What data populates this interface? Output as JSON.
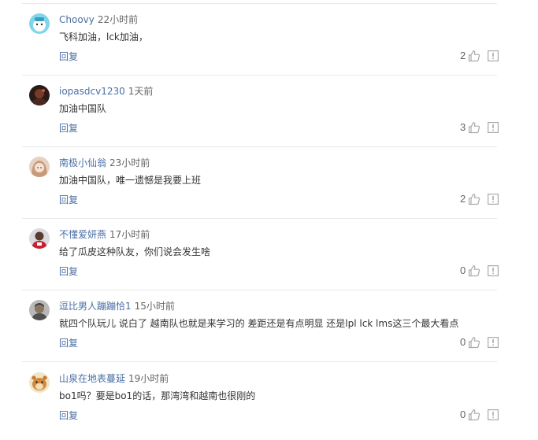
{
  "reply_label": "回复",
  "colors": {
    "username": "#4a6fa5",
    "time": "#666666",
    "text": "#333333",
    "divider": "#e9e9e9",
    "icon": "#aaaaaa"
  },
  "icons": {
    "like": "thumbs-up-icon",
    "report": "report-flag-icon"
  },
  "comments": [
    {
      "username": "Choovy",
      "time": "22小时前",
      "text": "飞科加油，lck加油，",
      "likes": "2",
      "avatar": "cartoon-face-avatar"
    },
    {
      "username": "iopasdcv1230",
      "time": "1天前",
      "text": "加油中国队",
      "likes": "3",
      "avatar": "dark-photo-avatar"
    },
    {
      "username": "南极小仙翁",
      "time": "23小时前",
      "text": "加油中国队，唯一遗憾是我要上班",
      "likes": "2",
      "avatar": "anime-girl-avatar"
    },
    {
      "username": "不懂爱妍燕",
      "time": "17小时前",
      "text": "给了瓜皮这种队友，你们说会发生啥",
      "likes": "0",
      "avatar": "athlete-avatar"
    },
    {
      "username": "逗比男人蹦蹦恰1",
      "time": "15小时前",
      "text": "就四个队玩儿 说白了 越南队也就是来学习的 差距还是有点明显 还是lpl lck lms这三个最大看点",
      "likes": "0",
      "avatar": "man-portrait-avatar"
    },
    {
      "username": "山泉在地表蔓延",
      "time": "19小时前",
      "text": "bo1吗？要是bo1的话，那湾湾和越南也很刚的",
      "likes": "0",
      "avatar": "hamster-avatar"
    }
  ]
}
